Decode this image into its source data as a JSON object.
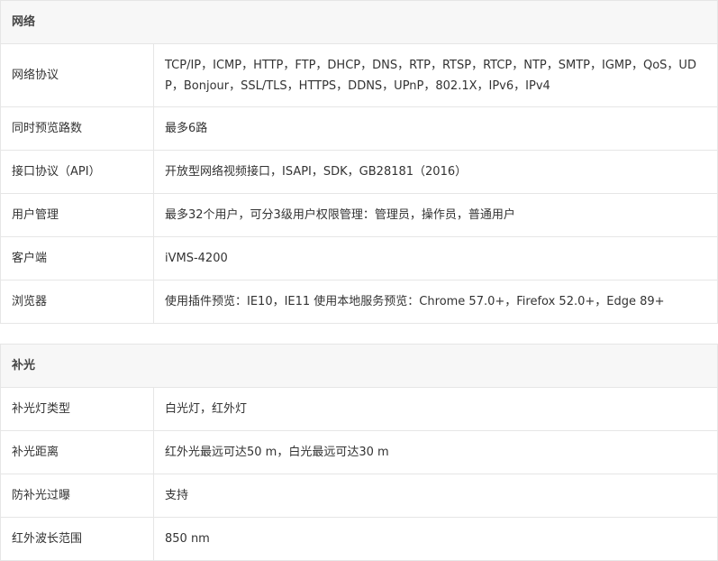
{
  "sections": [
    {
      "title": "网络",
      "rows": [
        {
          "key": "网络协议",
          "value": "TCP/IP，ICMP，HTTP，FTP，DHCP，DNS，RTP，RTSP，RTCP，NTP，SMTP，IGMP，QoS，UDP，Bonjour，SSL/TLS，HTTPS，DDNS，UPnP，802.1X，IPv6，IPv4"
        },
        {
          "key": "同时预览路数",
          "value": "最多6路"
        },
        {
          "key": "接口协议（API）",
          "value": "开放型网络视频接口，ISAPI，SDK，GB28181（2016）"
        },
        {
          "key": "用户管理",
          "value": "最多32个用户，可分3级用户权限管理：管理员，操作员，普通用户"
        },
        {
          "key": "客户端",
          "value": "iVMS-4200"
        },
        {
          "key": "浏览器",
          "value": "使用插件预览：IE10，IE11 使用本地服务预览：Chrome 57.0+，Firefox 52.0+，Edge 89+"
        }
      ]
    },
    {
      "title": "补光",
      "rows": [
        {
          "key": "补光灯类型",
          "value": "白光灯，红外灯"
        },
        {
          "key": "补光距离",
          "value": "红外光最远可达50 m，白光最远可达30 m"
        },
        {
          "key": "防补光过曝",
          "value": "支持"
        },
        {
          "key": "红外波长范围",
          "value": "850 nm"
        }
      ]
    }
  ]
}
